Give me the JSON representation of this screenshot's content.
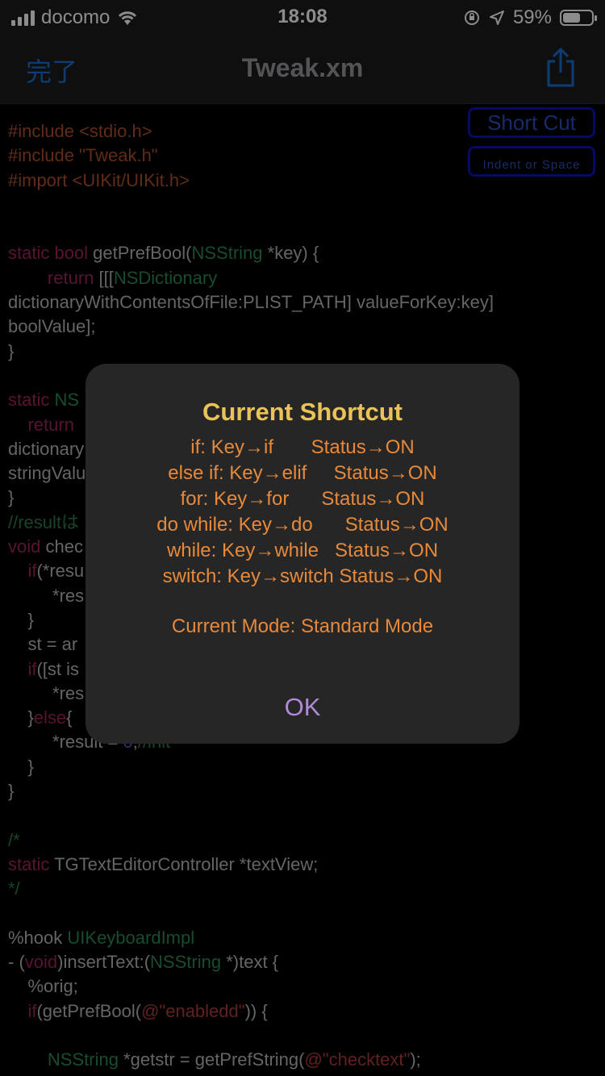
{
  "status_bar": {
    "carrier": "docomo",
    "time": "18:08",
    "battery": "59%"
  },
  "nav": {
    "done_label": "完了",
    "title": "Tweak.xm",
    "share_icon": "share-icon"
  },
  "editor": {
    "shortcut_button": "Short Cut",
    "indent_button": "Indent or Space",
    "lines": [
      [
        [
          "p",
          "#include <stdio.h>"
        ]
      ],
      [
        [
          "p",
          "#include \"Tweak.h\""
        ]
      ],
      [
        [
          "p",
          "#import <UIKit/UIKit.h>"
        ]
      ],
      [],
      [],
      [
        [
          "k",
          "static bool "
        ],
        [
          "x",
          "getPrefBool("
        ],
        [
          "t",
          "NSString"
        ],
        [
          "x",
          " *key) {"
        ]
      ],
      [
        [
          "x",
          "        "
        ],
        [
          "k",
          "return "
        ],
        [
          "x",
          "[[["
        ],
        [
          "t",
          "NSDictionary"
        ]
      ],
      [
        [
          "x",
          "dictionaryWithContentsOfFile:PLIST_PATH] valueForKey:key]"
        ]
      ],
      [
        [
          "x",
          "boolValue];"
        ]
      ],
      [
        [
          "x",
          "}"
        ]
      ],
      [],
      [
        [
          "k",
          "static "
        ],
        [
          "t",
          "NS"
        ],
        [
          "x",
          "                                                                  "
        ]
      ],
      [
        [
          "x",
          "    "
        ],
        [
          "k",
          "return"
        ]
      ],
      [
        [
          "x",
          "dictionary                                                       ey]"
        ]
      ],
      [
        [
          "x",
          "stringValu"
        ]
      ],
      [
        [
          "x",
          "}"
        ]
      ],
      [
        [
          "c",
          "//resultは"
        ]
      ],
      [
        [
          "k",
          "void "
        ],
        [
          "x",
          "chec"
        ]
      ],
      [
        [
          "x",
          "    "
        ],
        [
          "k",
          "if"
        ],
        [
          "x",
          "(*resu"
        ]
      ],
      [
        [
          "x",
          "         *res"
        ]
      ],
      [
        [
          "x",
          "    }"
        ]
      ],
      [
        [
          "x",
          "    st = ar"
        ]
      ],
      [
        [
          "x",
          "    "
        ],
        [
          "k",
          "if"
        ],
        [
          "x",
          "([st is"
        ]
      ],
      [
        [
          "x",
          "         *res"
        ]
      ],
      [
        [
          "x",
          "    }"
        ],
        [
          "k",
          "else"
        ],
        [
          "x",
          "{"
        ]
      ],
      [
        [
          "x",
          "         *result = "
        ],
        [
          "n",
          "0"
        ],
        [
          "x",
          ";"
        ],
        [
          "c",
          "//init"
        ]
      ],
      [
        [
          "x",
          "    }"
        ]
      ],
      [
        [
          "x",
          "}"
        ]
      ],
      [],
      [
        [
          "c",
          "/*"
        ]
      ],
      [
        [
          "k",
          "static "
        ],
        [
          "x",
          "TGTextEditorController *textView;"
        ]
      ],
      [
        [
          "c",
          "*/"
        ]
      ],
      [],
      [
        [
          "x",
          "%hook "
        ],
        [
          "t",
          "UIKeyboardImpl"
        ]
      ],
      [
        [
          "x",
          "- ("
        ],
        [
          "k",
          "void"
        ],
        [
          "x",
          ")insertText:("
        ],
        [
          "t",
          "NSString"
        ],
        [
          "x",
          " *)text {"
        ]
      ],
      [
        [
          "x",
          "    %orig;"
        ]
      ],
      [
        [
          "x",
          "    "
        ],
        [
          "k",
          "if"
        ],
        [
          "x",
          "(getPrefBool("
        ],
        [
          "s",
          "@\"enabledd\""
        ],
        [
          "x",
          ")) {"
        ]
      ],
      [],
      [
        [
          "x",
          "        "
        ],
        [
          "t",
          "NSString"
        ],
        [
          "x",
          " *getstr = getPrefString("
        ],
        [
          "s",
          "@\"checktext\""
        ],
        [
          "x",
          ");"
        ]
      ]
    ]
  },
  "alert": {
    "title": "Current Shortcut",
    "rows": [
      "if: Key→if       Status→ON",
      "else if: Key→elif     Status→ON",
      "for: Key→for      Status→ON",
      "do while: Key→do      Status→ON",
      "while: Key→while   Status→ON",
      "switch: Key→switch Status→ON"
    ],
    "mode": "Current Mode: Standard Mode",
    "ok_label": "OK"
  }
}
